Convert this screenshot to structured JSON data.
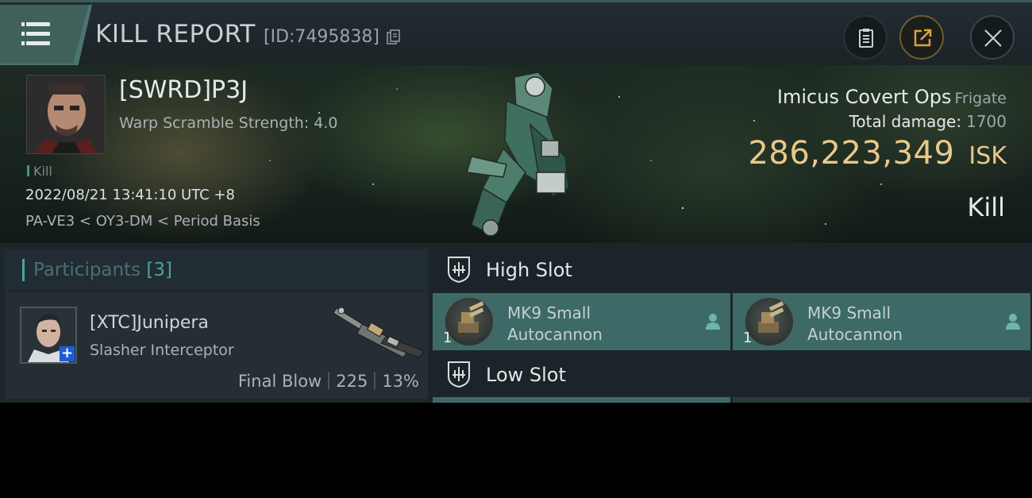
{
  "header": {
    "title": "KILL REPORT",
    "report_id": "[ID:7495838]",
    "icons": {
      "menu": "hamburger-menu-icon",
      "copy": "copy-icon",
      "clipboard": "clipboard-icon",
      "share": "share-icon",
      "close": "close-icon"
    }
  },
  "victim": {
    "pilot": "[SWRD]P3J",
    "warp_scramble": "Warp Scramble Strength: 4.0",
    "tag": "Kill",
    "timestamp": "2022/08/21 13:41:10 UTC +8",
    "location": "PA-VE3 < OY3-DM < Period Basis"
  },
  "ship": {
    "name": "Imicus Covert Ops",
    "class": "Frigate",
    "damage_label": "Total damage:",
    "damage_value": "1700",
    "isk_value": "286,223,349",
    "isk_unit": "ISK",
    "result": "Kill"
  },
  "participants": {
    "title": "Participants",
    "count": "[3]",
    "items": [
      {
        "name": "[XTC]Junipera",
        "ship": "Slasher Interceptor",
        "final_blow_label": "Final Blow",
        "damage": "225",
        "percent": "13%"
      }
    ]
  },
  "slots": {
    "high": {
      "label": "High Slot",
      "modules": [
        {
          "qty": "1",
          "name_line1": "MK9 Small",
          "name_line2": "Autocannon"
        },
        {
          "qty": "1",
          "name_line1": "MK9 Small",
          "name_line2": "Autocannon"
        }
      ]
    },
    "low": {
      "label": "Low Slot"
    }
  },
  "colors": {
    "accent_teal": "#4aa39d",
    "isk_gold": "#e8c98a",
    "module_bg": "#3d6a66"
  }
}
